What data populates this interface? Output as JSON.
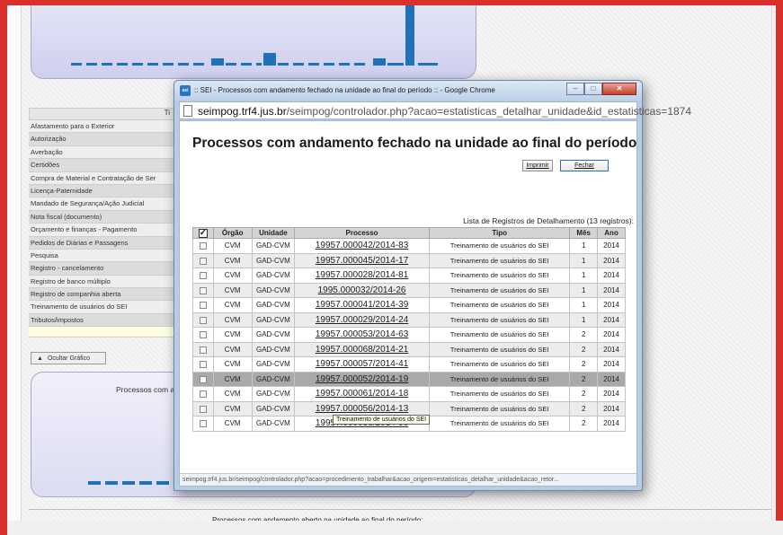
{
  "background": {
    "table_header_fragment": "Ti",
    "categories": [
      "Afastamento para o Exterior",
      "Autorização",
      "Averbação",
      "Certidões",
      "Compra de Material e Contratação de Ser",
      "Licença-Paternidade",
      "Mandado de Segurança/Ação Judicial",
      "Nota fiscal (documento)",
      "Orçamento e finanças - Pagamento",
      "Pedidos de Diárias e Passagens",
      "Pesquisa",
      "Registro - cancelamento",
      "Registro de banco múltiplo",
      "Registro de companhia aberta",
      "Treinamento de usuários do SEI",
      "Tributos/impostos"
    ],
    "hide_chart_label": "Ocultar Gráfico",
    "lower_chart_title": "Processos com a",
    "footer_text": "Processos com andamento aberto na unidade ao final do período:"
  },
  "window": {
    "title": ":: SEI - Processos com andamento fechado na unidade ao final do período :: - Google Chrome",
    "url_domain": "seimpog.trf4.jus.br",
    "url_path": "/seimpog/controlador.php?acao=estatisticas_detalhar_unidade&id_estatisticas=1874",
    "status_url": "seimpog.trf4.jus.br/seimpog/controlador.php?acao=procedimento_trabalhar&acao_origem=estatisticas_detalhar_unidade&acao_retor..."
  },
  "popup": {
    "title": "Processos com andamento fechado na unidade ao final do período",
    "print_label": "Imprimir",
    "close_label": "Fechar",
    "caption": "Lista de Registros de Detalhamento (13 registros):",
    "columns": [
      "Órgão",
      "Unidade",
      "Processo",
      "Tipo",
      "Mês",
      "Ano"
    ],
    "rows": [
      {
        "orgao": "CVM",
        "unidade": "GAD-CVM",
        "processo": "19957.000042/2014-83",
        "tipo": "Treinamento de usuários do SEI",
        "mes": "1",
        "ano": "2014"
      },
      {
        "orgao": "CVM",
        "unidade": "GAD-CVM",
        "processo": "19957.000045/2014-17",
        "tipo": "Treinamento de usuários do SEI",
        "mes": "1",
        "ano": "2014"
      },
      {
        "orgao": "CVM",
        "unidade": "GAD-CVM",
        "processo": "19957.000028/2014-81",
        "tipo": "Treinamento de usuários do SEI",
        "mes": "1",
        "ano": "2014"
      },
      {
        "orgao": "CVM",
        "unidade": "GAD-CVM",
        "processo": "1995.000032/2014-26",
        "tipo": "Treinamento de usuários do SEI",
        "mes": "1",
        "ano": "2014"
      },
      {
        "orgao": "CVM",
        "unidade": "GAD-CVM",
        "processo": "19957.000041/2014-39",
        "tipo": "Treinamento de usuários do SEI",
        "mes": "1",
        "ano": "2014"
      },
      {
        "orgao": "CVM",
        "unidade": "GAD-CVM",
        "processo": "19957.000029/2014-24",
        "tipo": "Treinamento de usuários do SEI",
        "mes": "1",
        "ano": "2014"
      },
      {
        "orgao": "CVM",
        "unidade": "GAD-CVM",
        "processo": "19957.000053/2014-63",
        "tipo": "Treinamento de usuários do SEI",
        "mes": "2",
        "ano": "2014"
      },
      {
        "orgao": "CVM",
        "unidade": "GAD-CVM",
        "processo": "19957.000068/2014-21",
        "tipo": "Treinamento de usuários do SEI",
        "mes": "2",
        "ano": "2014"
      },
      {
        "orgao": "CVM",
        "unidade": "GAD-CVM",
        "processo": "19957.000057/2014-41",
        "tipo": "Treinamento de usuários do SEI",
        "mes": "2",
        "ano": "2014"
      },
      {
        "orgao": "CVM",
        "unidade": "GAD-CVM",
        "processo": "19957.000052/2014-19",
        "tipo": "Treinamento de usuários do SEI",
        "mes": "2",
        "ano": "2014"
      },
      {
        "orgao": "CVM",
        "unidade": "GAD-CVM",
        "processo": "19957.000061/2014-18",
        "tipo": "Treinamento de usuários do SEI",
        "mes": "2",
        "ano": "2014"
      },
      {
        "orgao": "CVM",
        "unidade": "GAD-CVM",
        "processo": "19957.000056/2014-13",
        "tipo": "Treinamento de usuários do SEI",
        "mes": "2",
        "ano": "2014"
      },
      {
        "orgao": "CVM",
        "unidade": "GAD-CVM",
        "processo": "19957.000058/2014-96",
        "tipo": "Treinamento de usuários do SEI",
        "mes": "2",
        "ano": "2014"
      }
    ],
    "tooltip": "Treinamento de usuários do SEI"
  },
  "colors": {
    "frame": "#d9302c",
    "chart_bar": "#1e73b8",
    "selected_row": "#a9a9a9"
  }
}
